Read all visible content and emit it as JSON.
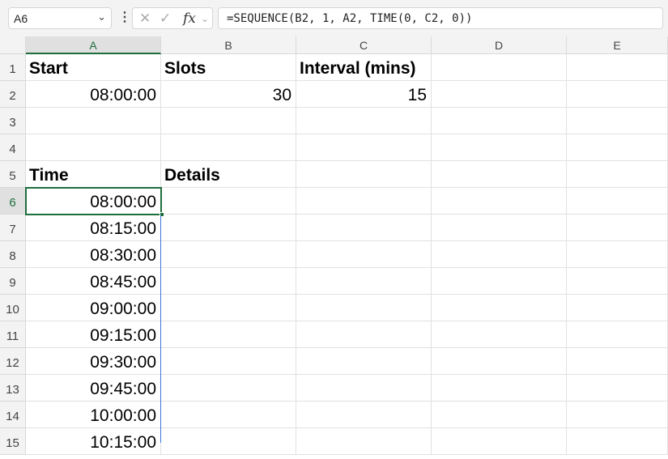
{
  "name_box": "A6",
  "formula": "=SEQUENCE(B2, 1, A2, TIME(0, C2, 0))",
  "columns": [
    "A",
    "B",
    "C",
    "D",
    "E"
  ],
  "rows": [
    "1",
    "2",
    "3",
    "4",
    "5",
    "6",
    "7",
    "8",
    "9",
    "10",
    "11",
    "12",
    "13",
    "14",
    "15"
  ],
  "cells": {
    "A1": "Start",
    "B1": "Slots",
    "C1": "Interval (mins)",
    "A2": "08:00:00",
    "B2": "30",
    "C2": "15",
    "A5": "Time",
    "B5": "Details",
    "A6": "08:00:00",
    "A7": "08:15:00",
    "A8": "08:30:00",
    "A9": "08:45:00",
    "A10": "09:00:00",
    "A11": "09:15:00",
    "A12": "09:30:00",
    "A13": "09:45:00",
    "A14": "10:00:00",
    "A15": "10:15:00"
  }
}
